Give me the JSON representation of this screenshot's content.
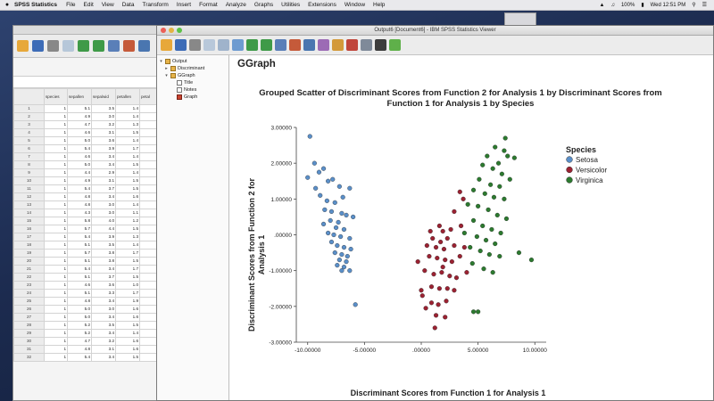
{
  "menubar": {
    "app_name": "SPSS Statistics",
    "items": [
      "File",
      "Edit",
      "View",
      "Data",
      "Transform",
      "Insert",
      "Format",
      "Analyze",
      "Graphs",
      "Utilities",
      "Extensions",
      "Window",
      "Help"
    ],
    "battery": "100%",
    "clock": "Wed 12:51 PM"
  },
  "data_editor": {
    "columns": [
      "species",
      "sepallen",
      "sepalwid",
      "petallen",
      "petal"
    ],
    "rows": [
      [
        1,
        "1",
        "5.1",
        "3.5",
        "1.4"
      ],
      [
        2,
        "1",
        "4.9",
        "3.0",
        "1.4"
      ],
      [
        3,
        "1",
        "4.7",
        "3.2",
        "1.3"
      ],
      [
        4,
        "1",
        "4.6",
        "3.1",
        "1.5"
      ],
      [
        5,
        "1",
        "5.0",
        "3.6",
        "1.4"
      ],
      [
        6,
        "1",
        "5.4",
        "3.9",
        "1.7"
      ],
      [
        7,
        "1",
        "4.6",
        "3.4",
        "1.4"
      ],
      [
        8,
        "1",
        "5.0",
        "3.4",
        "1.5"
      ],
      [
        9,
        "1",
        "4.4",
        "2.9",
        "1.4"
      ],
      [
        10,
        "1",
        "4.9",
        "3.1",
        "1.5"
      ],
      [
        11,
        "1",
        "5.4",
        "3.7",
        "1.5"
      ],
      [
        12,
        "1",
        "4.8",
        "3.4",
        "1.6"
      ],
      [
        13,
        "1",
        "4.8",
        "3.0",
        "1.4"
      ],
      [
        14,
        "1",
        "4.3",
        "3.0",
        "1.1"
      ],
      [
        15,
        "1",
        "5.8",
        "4.0",
        "1.2"
      ],
      [
        16,
        "1",
        "5.7",
        "4.4",
        "1.5"
      ],
      [
        17,
        "1",
        "5.4",
        "3.9",
        "1.3"
      ],
      [
        18,
        "1",
        "5.1",
        "3.5",
        "1.4"
      ],
      [
        19,
        "1",
        "5.7",
        "3.8",
        "1.7"
      ],
      [
        20,
        "1",
        "5.1",
        "3.8",
        "1.5"
      ],
      [
        21,
        "1",
        "5.4",
        "3.4",
        "1.7"
      ],
      [
        22,
        "1",
        "5.1",
        "3.7",
        "1.5"
      ],
      [
        23,
        "1",
        "4.6",
        "3.6",
        "1.0"
      ],
      [
        24,
        "1",
        "5.1",
        "3.3",
        "1.7"
      ],
      [
        25,
        "1",
        "4.8",
        "3.4",
        "1.9"
      ],
      [
        26,
        "1",
        "5.0",
        "3.0",
        "1.6"
      ],
      [
        27,
        "1",
        "5.0",
        "3.4",
        "1.6"
      ],
      [
        28,
        "1",
        "5.2",
        "3.5",
        "1.5"
      ],
      [
        29,
        "1",
        "5.2",
        "3.4",
        "1.4"
      ],
      [
        30,
        "1",
        "4.7",
        "3.2",
        "1.6"
      ],
      [
        31,
        "1",
        "4.8",
        "3.1",
        "1.6"
      ],
      [
        32,
        "1",
        "5.4",
        "3.4",
        "1.5"
      ]
    ]
  },
  "viewer": {
    "window_title": "Output6 [Document6] - IBM SPSS Statistics Viewer",
    "tree": [
      {
        "label": "Output",
        "icon": "output-book-icon"
      },
      {
        "label": "Discriminant",
        "icon": "book-icon"
      },
      {
        "label": "GGraph",
        "icon": "book-icon"
      },
      {
        "label": "Title",
        "icon": "doc-icon"
      },
      {
        "label": "Notes",
        "icon": "doc-icon"
      },
      {
        "label": "Graph",
        "icon": "chart-icon"
      }
    ],
    "section_title": "GGraph"
  },
  "chart_data": {
    "type": "scatter",
    "title": "Grouped Scatter of Discriminant Scores from Function 2 for Analysis 1 by Discriminant Scores from Function 1 for Analysis 1 by Species",
    "title_lines": [
      "Grouped Scatter of Discriminant Scores from Function 2 for Analysis 1 by Discriminant Scores from",
      "Function 1 for Analysis 1 by Species"
    ],
    "xlabel": "Discriminant Scores from Function 1 for Analysis 1",
    "ylabel_lines": [
      "Discriminant Scores from Function 2 for",
      "Analysis 1"
    ],
    "xlim": [
      -11,
      11
    ],
    "ylim": [
      -3,
      3
    ],
    "x_ticks": [
      -10,
      -5,
      0,
      5,
      10
    ],
    "x_tick_labels": [
      "-10.00000",
      "-5.00000",
      ".00000",
      "5.00000",
      "10.00000"
    ],
    "y_ticks": [
      3,
      2,
      1,
      0,
      -1,
      -2,
      -3
    ],
    "y_tick_labels": [
      "3.00000",
      "2.00000",
      "1.00000",
      ".00000",
      "-1.00000",
      "-2.00000",
      "-3.00000"
    ],
    "legend_title": "Species",
    "legend_position": "top-right",
    "grid": false,
    "series": [
      {
        "name": "Setosa",
        "color": "#5a8fc9",
        "points": [
          [
            -9.8,
            2.75
          ],
          [
            -9.4,
            2.0
          ],
          [
            -8.6,
            1.85
          ],
          [
            -10.0,
            1.6
          ],
          [
            -9.0,
            1.75
          ],
          [
            -8.2,
            1.5
          ],
          [
            -9.3,
            1.3
          ],
          [
            -8.9,
            1.1
          ],
          [
            -7.8,
            1.55
          ],
          [
            -7.2,
            1.35
          ],
          [
            -6.9,
            1.05
          ],
          [
            -6.3,
            1.3
          ],
          [
            -8.3,
            0.95
          ],
          [
            -7.6,
            0.9
          ],
          [
            -8.5,
            0.7
          ],
          [
            -7.9,
            0.65
          ],
          [
            -7.0,
            0.6
          ],
          [
            -6.6,
            0.55
          ],
          [
            -6.0,
            0.5
          ],
          [
            -8.0,
            0.4
          ],
          [
            -7.3,
            0.35
          ],
          [
            -8.6,
            0.3
          ],
          [
            -7.5,
            0.2
          ],
          [
            -6.8,
            0.15
          ],
          [
            -8.2,
            0.05
          ],
          [
            -7.7,
            0.0
          ],
          [
            -7.1,
            -0.05
          ],
          [
            -6.3,
            -0.1
          ],
          [
            -7.9,
            -0.2
          ],
          [
            -7.4,
            -0.3
          ],
          [
            -6.8,
            -0.35
          ],
          [
            -6.2,
            -0.4
          ],
          [
            -7.6,
            -0.5
          ],
          [
            -7.0,
            -0.55
          ],
          [
            -6.5,
            -0.6
          ],
          [
            -7.2,
            -0.7
          ],
          [
            -6.6,
            -0.75
          ],
          [
            -7.4,
            -0.85
          ],
          [
            -6.8,
            -0.9
          ],
          [
            -7.0,
            -1.0
          ],
          [
            -6.3,
            -1.0
          ],
          [
            -5.8,
            -1.95
          ]
        ]
      },
      {
        "name": "Versicolor",
        "color": "#9b2232",
        "points": [
          [
            3.4,
            1.2
          ],
          [
            3.7,
            1.0
          ],
          [
            2.9,
            0.65
          ],
          [
            1.6,
            0.25
          ],
          [
            0.8,
            0.1
          ],
          [
            1.9,
            0.1
          ],
          [
            2.6,
            0.15
          ],
          [
            3.5,
            0.25
          ],
          [
            1.0,
            -0.1
          ],
          [
            1.7,
            -0.2
          ],
          [
            2.3,
            -0.1
          ],
          [
            0.5,
            -0.3
          ],
          [
            1.3,
            -0.35
          ],
          [
            2.0,
            -0.4
          ],
          [
            2.9,
            -0.3
          ],
          [
            3.8,
            -0.35
          ],
          [
            -0.3,
            -0.75
          ],
          [
            0.7,
            -0.6
          ],
          [
            1.4,
            -0.65
          ],
          [
            2.1,
            -0.7
          ],
          [
            2.7,
            -0.75
          ],
          [
            3.4,
            -0.6
          ],
          [
            0.3,
            -1.0
          ],
          [
            1.1,
            -1.1
          ],
          [
            1.8,
            -1.05
          ],
          [
            2.5,
            -1.15
          ],
          [
            3.1,
            -1.2
          ],
          [
            4.0,
            -1.05
          ],
          [
            0.9,
            -1.45
          ],
          [
            1.6,
            -1.5
          ],
          [
            2.3,
            -1.5
          ],
          [
            0.1,
            -1.7
          ],
          [
            0.9,
            -1.9
          ],
          [
            1.5,
            -1.95
          ],
          [
            2.2,
            -1.85
          ],
          [
            2.9,
            -1.55
          ],
          [
            0.4,
            -2.05
          ],
          [
            1.3,
            -2.25
          ],
          [
            2.1,
            -2.3
          ],
          [
            0.0,
            -1.55
          ],
          [
            1.9,
            -0.9
          ],
          [
            1.2,
            -2.6
          ]
        ]
      },
      {
        "name": "Virginica",
        "color": "#2c7a2f",
        "points": [
          [
            7.4,
            2.7
          ],
          [
            6.5,
            2.45
          ],
          [
            8.2,
            2.15
          ],
          [
            5.8,
            2.2
          ],
          [
            7.3,
            2.35
          ],
          [
            6.8,
            2.0
          ],
          [
            7.6,
            2.2
          ],
          [
            5.4,
            1.95
          ],
          [
            6.3,
            1.85
          ],
          [
            7.1,
            1.7
          ],
          [
            7.8,
            1.55
          ],
          [
            5.1,
            1.55
          ],
          [
            6.1,
            1.4
          ],
          [
            6.9,
            1.35
          ],
          [
            4.6,
            1.25
          ],
          [
            5.6,
            1.15
          ],
          [
            6.4,
            1.05
          ],
          [
            7.3,
            1.0
          ],
          [
            4.1,
            0.85
          ],
          [
            5.0,
            0.8
          ],
          [
            5.9,
            0.7
          ],
          [
            6.7,
            0.55
          ],
          [
            7.5,
            0.45
          ],
          [
            4.6,
            0.4
          ],
          [
            5.4,
            0.25
          ],
          [
            6.2,
            0.15
          ],
          [
            7.0,
            0.05
          ],
          [
            3.8,
            0.05
          ],
          [
            4.9,
            -0.05
          ],
          [
            5.7,
            -0.15
          ],
          [
            6.5,
            -0.25
          ],
          [
            4.3,
            -0.35
          ],
          [
            5.2,
            -0.45
          ],
          [
            6.0,
            -0.55
          ],
          [
            6.9,
            -0.6
          ],
          [
            4.5,
            -0.8
          ],
          [
            5.5,
            -0.95
          ],
          [
            6.3,
            -1.05
          ],
          [
            8.6,
            -0.5
          ],
          [
            9.7,
            -0.7
          ],
          [
            5.0,
            -2.15
          ],
          [
            4.6,
            -2.15
          ]
        ]
      }
    ]
  }
}
